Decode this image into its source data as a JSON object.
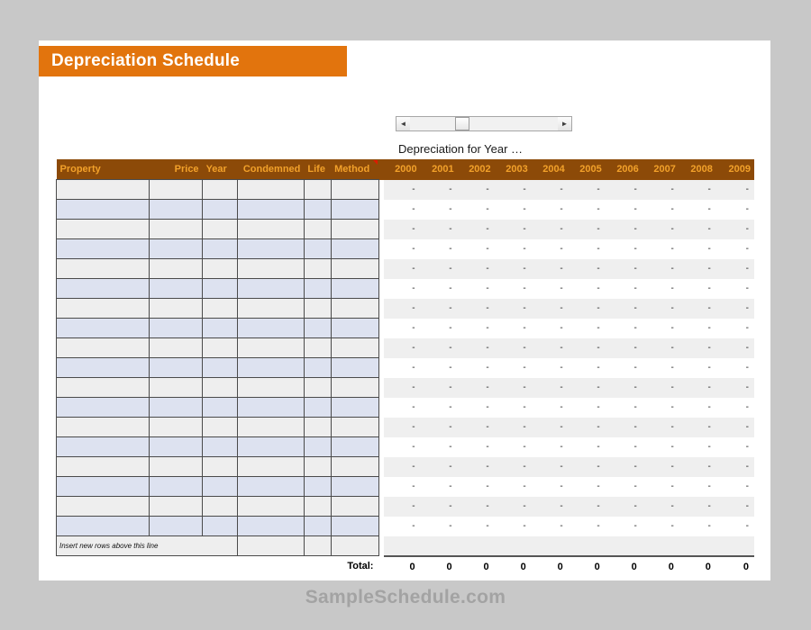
{
  "title": "Depreciation Schedule",
  "footer": "SampleSchedule.com",
  "scrollbar": {
    "left_arrow": "◄",
    "right_arrow": "►"
  },
  "year_caption": "Depreciation for Year …",
  "columns": {
    "left": [
      {
        "label": "Property",
        "align": "left"
      },
      {
        "label": "Price",
        "align": "right"
      },
      {
        "label": "Year",
        "align": "left"
      },
      {
        "label": "Condemned",
        "align": "right"
      },
      {
        "label": "Life",
        "align": "left"
      },
      {
        "label": "Method",
        "align": "left"
      }
    ],
    "years": [
      "2000",
      "2001",
      "2002",
      "2003",
      "2004",
      "2005",
      "2006",
      "2007",
      "2008",
      "2009"
    ]
  },
  "rows": [
    {
      "property": "",
      "price": "",
      "year": "",
      "condemned": "",
      "life": "",
      "method": "",
      "values": [
        "-",
        "-",
        "-",
        "-",
        "-",
        "-",
        "-",
        "-",
        "-",
        "-"
      ]
    },
    {
      "property": "",
      "price": "",
      "year": "",
      "condemned": "",
      "life": "",
      "method": "",
      "values": [
        "-",
        "-",
        "-",
        "-",
        "-",
        "-",
        "-",
        "-",
        "-",
        "-"
      ]
    },
    {
      "property": "",
      "price": "",
      "year": "",
      "condemned": "",
      "life": "",
      "method": "",
      "values": [
        "-",
        "-",
        "-",
        "-",
        "-",
        "-",
        "-",
        "-",
        "-",
        "-"
      ]
    },
    {
      "property": "",
      "price": "",
      "year": "",
      "condemned": "",
      "life": "",
      "method": "",
      "values": [
        "-",
        "-",
        "-",
        "-",
        "-",
        "-",
        "-",
        "-",
        "-",
        "-"
      ]
    },
    {
      "property": "",
      "price": "",
      "year": "",
      "condemned": "",
      "life": "",
      "method": "",
      "values": [
        "-",
        "-",
        "-",
        "-",
        "-",
        "-",
        "-",
        "-",
        "-",
        "-"
      ]
    },
    {
      "property": "",
      "price": "",
      "year": "",
      "condemned": "",
      "life": "",
      "method": "",
      "values": [
        "-",
        "-",
        "-",
        "-",
        "-",
        "-",
        "-",
        "-",
        "-",
        "-"
      ]
    },
    {
      "property": "",
      "price": "",
      "year": "",
      "condemned": "",
      "life": "",
      "method": "",
      "values": [
        "-",
        "-",
        "-",
        "-",
        "-",
        "-",
        "-",
        "-",
        "-",
        "-"
      ]
    },
    {
      "property": "",
      "price": "",
      "year": "",
      "condemned": "",
      "life": "",
      "method": "",
      "values": [
        "-",
        "-",
        "-",
        "-",
        "-",
        "-",
        "-",
        "-",
        "-",
        "-"
      ]
    },
    {
      "property": "",
      "price": "",
      "year": "",
      "condemned": "",
      "life": "",
      "method": "",
      "values": [
        "-",
        "-",
        "-",
        "-",
        "-",
        "-",
        "-",
        "-",
        "-",
        "-"
      ]
    },
    {
      "property": "",
      "price": "",
      "year": "",
      "condemned": "",
      "life": "",
      "method": "",
      "values": [
        "-",
        "-",
        "-",
        "-",
        "-",
        "-",
        "-",
        "-",
        "-",
        "-"
      ]
    },
    {
      "property": "",
      "price": "",
      "year": "",
      "condemned": "",
      "life": "",
      "method": "",
      "values": [
        "-",
        "-",
        "-",
        "-",
        "-",
        "-",
        "-",
        "-",
        "-",
        "-"
      ]
    },
    {
      "property": "",
      "price": "",
      "year": "",
      "condemned": "",
      "life": "",
      "method": "",
      "values": [
        "-",
        "-",
        "-",
        "-",
        "-",
        "-",
        "-",
        "-",
        "-",
        "-"
      ]
    },
    {
      "property": "",
      "price": "",
      "year": "",
      "condemned": "",
      "life": "",
      "method": "",
      "values": [
        "-",
        "-",
        "-",
        "-",
        "-",
        "-",
        "-",
        "-",
        "-",
        "-"
      ]
    },
    {
      "property": "",
      "price": "",
      "year": "",
      "condemned": "",
      "life": "",
      "method": "",
      "values": [
        "-",
        "-",
        "-",
        "-",
        "-",
        "-",
        "-",
        "-",
        "-",
        "-"
      ]
    },
    {
      "property": "",
      "price": "",
      "year": "",
      "condemned": "",
      "life": "",
      "method": "",
      "values": [
        "-",
        "-",
        "-",
        "-",
        "-",
        "-",
        "-",
        "-",
        "-",
        "-"
      ]
    },
    {
      "property": "",
      "price": "",
      "year": "",
      "condemned": "",
      "life": "",
      "method": "",
      "values": [
        "-",
        "-",
        "-",
        "-",
        "-",
        "-",
        "-",
        "-",
        "-",
        "-"
      ]
    },
    {
      "property": "",
      "price": "",
      "year": "",
      "condemned": "",
      "life": "",
      "method": "",
      "values": [
        "-",
        "-",
        "-",
        "-",
        "-",
        "-",
        "-",
        "-",
        "-",
        "-"
      ]
    },
    {
      "property": "",
      "price": "",
      "year": "",
      "condemned": "",
      "life": "",
      "method": "",
      "values": [
        "-",
        "-",
        "-",
        "-",
        "-",
        "-",
        "-",
        "-",
        "-",
        "-"
      ]
    }
  ],
  "insert_row": {
    "note": "Insert new rows above this line",
    "values": [
      "",
      "",
      "",
      "",
      "",
      "",
      "",
      "",
      "",
      ""
    ]
  },
  "total": {
    "label": "Total:",
    "values": [
      "0",
      "0",
      "0",
      "0",
      "0",
      "0",
      "0",
      "0",
      "0",
      "0"
    ]
  },
  "colors": {
    "title_bar": "#e2740d",
    "header_bg": "#8c4a08",
    "header_text": "#f2a12a",
    "row_shade_blue": "#dde2f0",
    "row_shade_gray": "#eeeeee",
    "canvas": "#c8c8c8",
    "footer_text": "#a3a3a3",
    "comment_marker": "#e01b00"
  }
}
